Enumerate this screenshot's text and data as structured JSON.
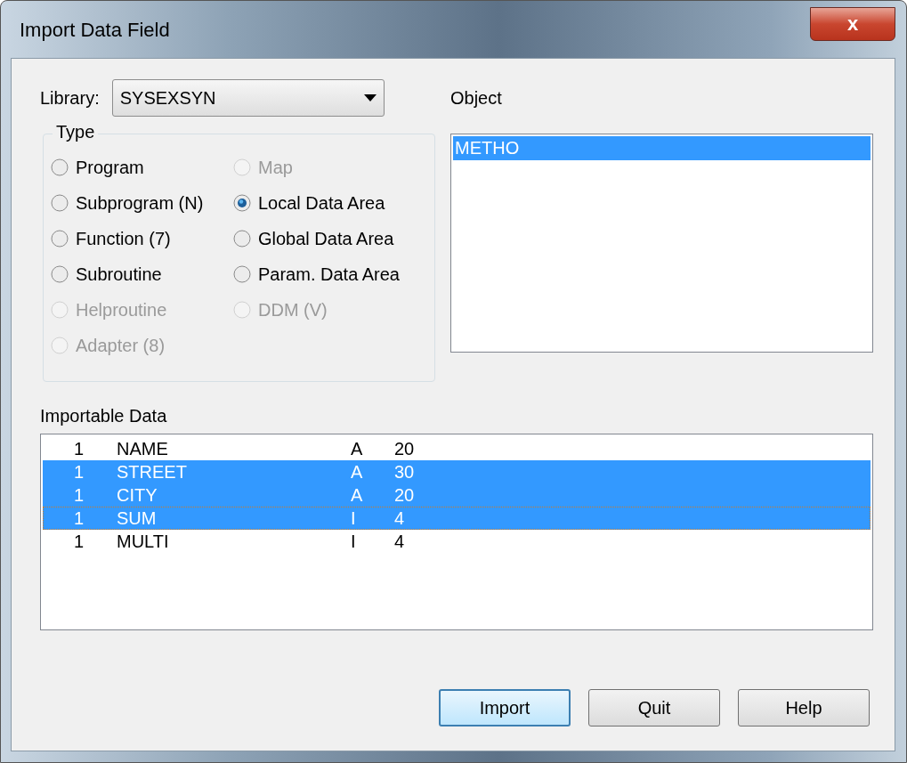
{
  "window": {
    "title": "Import Data Field",
    "close": "x"
  },
  "library": {
    "label": "Library:",
    "value": "SYSEXSYN"
  },
  "type_group": {
    "title": "Type",
    "options": [
      {
        "label": "Program",
        "selected": false,
        "disabled": false
      },
      {
        "label": "Map",
        "selected": false,
        "disabled": true
      },
      {
        "label": "Subprogram (N)",
        "selected": false,
        "disabled": false
      },
      {
        "label": "Local Data Area",
        "selected": true,
        "disabled": false
      },
      {
        "label": "Function (7)",
        "selected": false,
        "disabled": false
      },
      {
        "label": "Global Data Area",
        "selected": false,
        "disabled": false
      },
      {
        "label": "Subroutine",
        "selected": false,
        "disabled": false
      },
      {
        "label": "Param. Data Area",
        "selected": false,
        "disabled": false
      },
      {
        "label": "Helproutine",
        "selected": false,
        "disabled": true
      },
      {
        "label": "DDM (V)",
        "selected": false,
        "disabled": true
      },
      {
        "label": "Adapter (8)",
        "selected": false,
        "disabled": true
      }
    ]
  },
  "object": {
    "label": "Object",
    "items": [
      {
        "label": "METHO",
        "selected": true
      }
    ]
  },
  "importable": {
    "label": "Importable Data",
    "rows": [
      {
        "level": "1",
        "name": "NAME",
        "type": "A",
        "length": "20",
        "selected": false,
        "focused": false
      },
      {
        "level": "1",
        "name": "STREET",
        "type": "A",
        "length": "30",
        "selected": true,
        "focused": false
      },
      {
        "level": "1",
        "name": "CITY",
        "type": "A",
        "length": "20",
        "selected": true,
        "focused": false
      },
      {
        "level": "1",
        "name": "SUM",
        "type": "I",
        "length": "4",
        "selected": true,
        "focused": true
      },
      {
        "level": "1",
        "name": "MULTI",
        "type": "I",
        "length": "4",
        "selected": false,
        "focused": false
      }
    ]
  },
  "buttons": [
    {
      "label": "Import",
      "default": true
    },
    {
      "label": "Quit",
      "default": false
    },
    {
      "label": "Help",
      "default": false
    }
  ]
}
